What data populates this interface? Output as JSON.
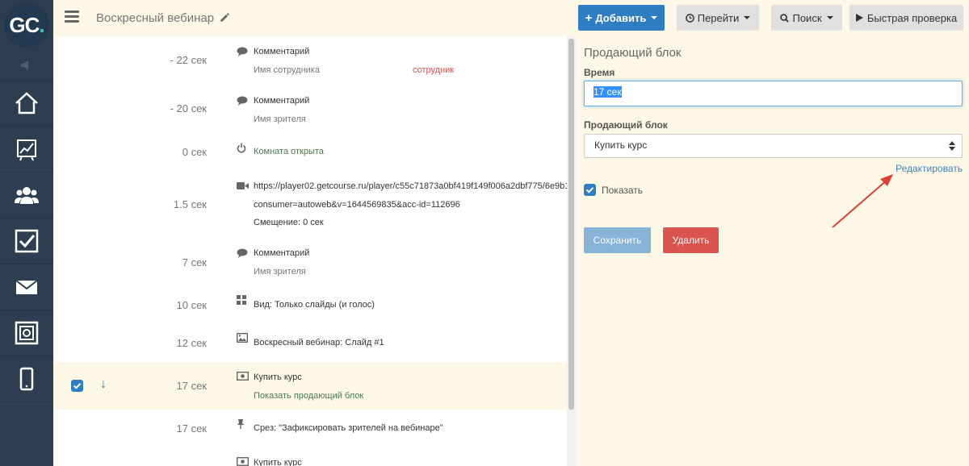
{
  "logo": {
    "text": "GC",
    "dot": "."
  },
  "header": {
    "title": "Воскресный вебинар",
    "add_label": "Добавить",
    "go_label": "Перейти",
    "search_label": "Поиск",
    "quick_check_label": "Быстрая проверка"
  },
  "timeline": [
    {
      "time": "- 22 сек",
      "icon": "comment-icon",
      "line1": "Комментарий",
      "line2": "Имя сотрудника",
      "badge": "сотрудник"
    },
    {
      "time": "- 20 сек",
      "icon": "comment-icon",
      "line1": "Комментарий",
      "line2": "Имя зрителя"
    },
    {
      "time": "0 сек",
      "icon": "power-icon",
      "line1": "Комната открыта"
    },
    {
      "time": "1.5 сек",
      "icon": "video-icon",
      "line1": "https://player02.getcourse.ru/player/c55c71873a0bf419f149f006a2dbf775/6e9b1",
      "line2": "consumer=autoweb&v=1644569835&acc-id=112696",
      "line3": "Смещение: 0 сек"
    },
    {
      "time": "7 сек",
      "icon": "comment-icon",
      "line1": "Комментарий",
      "line2": "Имя зрителя"
    },
    {
      "time": "10 сек",
      "icon": "grid-icon",
      "line1": "Вид: Только слайды (и голос)"
    },
    {
      "time": "12 сек",
      "icon": "image-icon",
      "line1": "Воскресный вебинар: Слайд #1"
    },
    {
      "time": "17 сек",
      "icon": "money-icon",
      "line1": "Купить курс",
      "line2": "Показать продающий блок"
    },
    {
      "time": "17 сек",
      "icon": "pin-icon",
      "line1": "Срез: \"Зафиксировать зрителей на вебинаре\""
    },
    {
      "time": "",
      "icon": "money-icon",
      "line1": "Купить курс"
    }
  ],
  "panel": {
    "title": "Продающий блок",
    "time_label": "Время",
    "time_value": "17 сек",
    "block_label": "Продающий блок",
    "block_value": "Купить курс",
    "edit_link": "Редактировать",
    "show_label": "Показать",
    "save_label": "Сохранить",
    "delete_label": "Удалить"
  },
  "colors": {
    "sidebar": "#2c3e50",
    "primary": "#2f7dc3",
    "danger": "#d9534f",
    "panel_bg": "#fdf8e6",
    "annotation_arrow": "#e0402f"
  }
}
